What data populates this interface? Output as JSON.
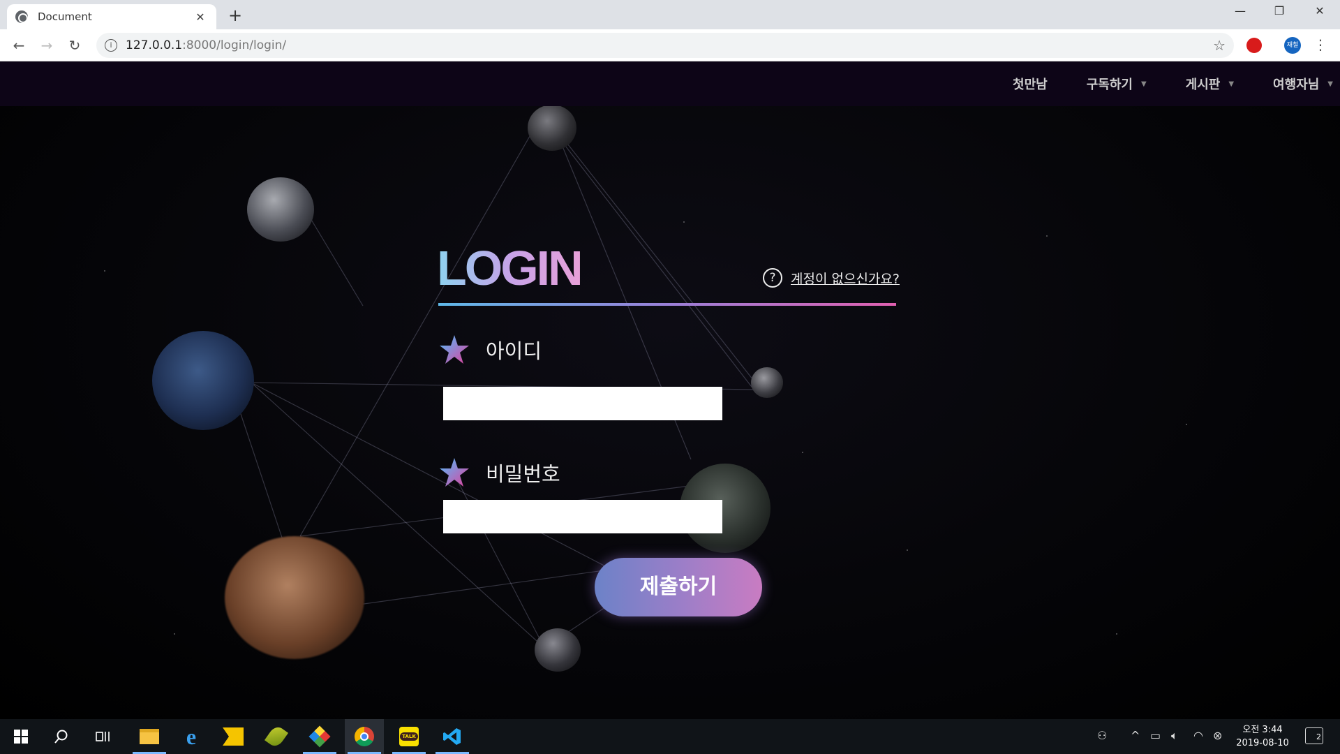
{
  "browser": {
    "tab_title": "Document",
    "url_host": "127.0.0.1",
    "url_rest": ":8000/login/login/",
    "profile_initials": "재철"
  },
  "nav": {
    "items": [
      {
        "label": "첫만남",
        "has_dropdown": false
      },
      {
        "label": "구독하기",
        "has_dropdown": true
      },
      {
        "label": "게시판",
        "has_dropdown": true
      },
      {
        "label": "여행자님",
        "has_dropdown": true
      }
    ]
  },
  "login": {
    "title": "LOGIN",
    "help_link": "계정이 없으신가요?",
    "id_label": "아이디",
    "password_label": "비밀번호",
    "id_value": "",
    "password_value": "",
    "submit_label": "제출하기"
  },
  "taskbar": {
    "clock_time": "오전 3:44",
    "clock_date": "2019-08-10",
    "notification_count": "2",
    "kakaotalk_label": "TALK"
  },
  "colors": {
    "accent_blue": "#5fb8e8",
    "accent_pink": "#e060b0",
    "submit_start": "#6c82c8",
    "submit_end": "#c97cc2"
  }
}
